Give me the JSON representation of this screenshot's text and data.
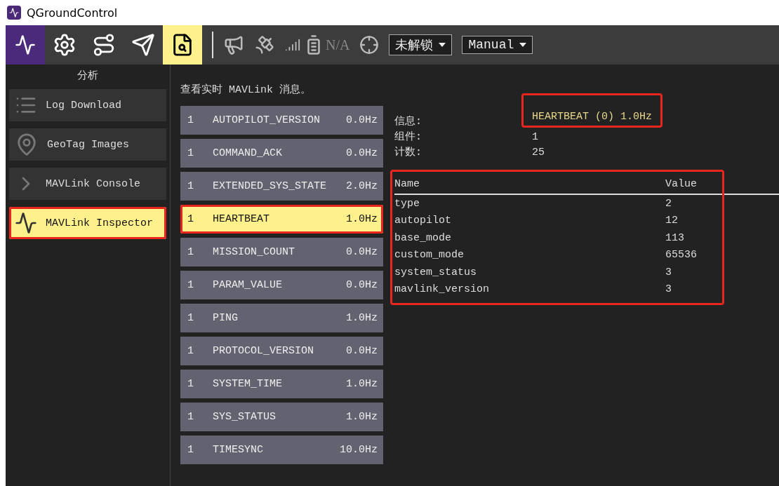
{
  "window": {
    "title": "QGroundControl"
  },
  "toolbar": {
    "tools": [
      {
        "kind": "logo",
        "selected": false
      },
      {
        "kind": "settings",
        "selected": false
      },
      {
        "kind": "plan",
        "selected": false
      },
      {
        "kind": "fly",
        "selected": false
      },
      {
        "kind": "analyze",
        "selected": true
      }
    ],
    "battery": "N/A",
    "arm_state": "未解锁",
    "flight_mode": "Manual"
  },
  "sidebar": {
    "title": "分析",
    "items": [
      {
        "kind": "log",
        "label": "Log Download",
        "selected": false,
        "highlighted": false
      },
      {
        "kind": "geotag",
        "label": "GeoTag Images",
        "selected": false,
        "highlighted": false
      },
      {
        "kind": "console",
        "label": "MAVLink Console",
        "selected": false,
        "highlighted": false
      },
      {
        "kind": "inspector",
        "label": "MAVLink Inspector",
        "selected": true,
        "highlighted": true
      }
    ]
  },
  "inspector": {
    "heading": "查看实时 MAVLink 消息。",
    "messages": [
      {
        "component": "1",
        "name": "AUTOPILOT_VERSION",
        "rate": "0.0Hz",
        "selected": false
      },
      {
        "component": "1",
        "name": "COMMAND_ACK",
        "rate": "0.0Hz",
        "selected": false
      },
      {
        "component": "1",
        "name": "EXTENDED_SYS_STATE",
        "rate": "2.0Hz",
        "selected": false
      },
      {
        "component": "1",
        "name": "HEARTBEAT",
        "rate": "1.0Hz",
        "selected": true,
        "highlighted": true
      },
      {
        "component": "1",
        "name": "MISSION_COUNT",
        "rate": "0.0Hz",
        "selected": false
      },
      {
        "component": "1",
        "name": "PARAM_VALUE",
        "rate": "0.0Hz",
        "selected": false
      },
      {
        "component": "1",
        "name": "PING",
        "rate": "1.0Hz",
        "selected": false
      },
      {
        "component": "1",
        "name": "PROTOCOL_VERSION",
        "rate": "0.0Hz",
        "selected": false
      },
      {
        "component": "1",
        "name": "SYSTEM_TIME",
        "rate": "1.0Hz",
        "selected": false
      },
      {
        "component": "1",
        "name": "SYS_STATUS",
        "rate": "1.0Hz",
        "selected": false
      },
      {
        "component": "1",
        "name": "TIMESYNC",
        "rate": "10.0Hz",
        "selected": false
      }
    ],
    "details": [
      {
        "label": "信息:",
        "value": "HEARTBEAT (0) 1.0Hz",
        "highlighted": true
      },
      {
        "label": "组件:",
        "value": "1",
        "highlighted": false
      },
      {
        "label": "计数:",
        "value": "25",
        "highlighted": false
      }
    ],
    "fields": {
      "highlighted": true,
      "columns": [
        "Name",
        "Value"
      ],
      "rows": [
        [
          "type",
          "2"
        ],
        [
          "autopilot",
          "12"
        ],
        [
          "base_mode",
          "113"
        ],
        [
          "custom_mode",
          "65536"
        ],
        [
          "system_status",
          "3"
        ],
        [
          "mavlink_version",
          "3"
        ]
      ]
    }
  }
}
